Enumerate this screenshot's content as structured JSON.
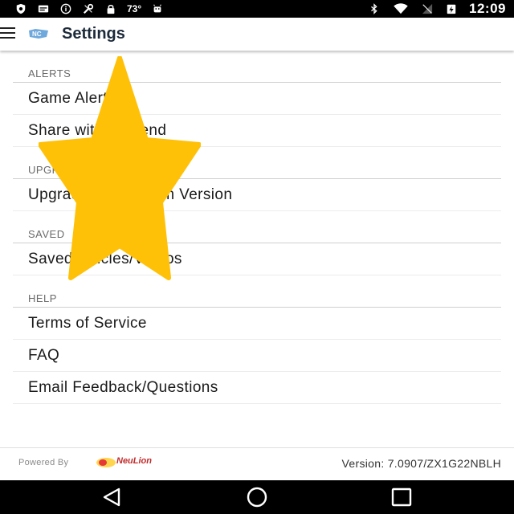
{
  "status_bar": {
    "temperature": "73°",
    "time": "12:09",
    "icons": [
      "shield-icon",
      "message-icon",
      "info-icon",
      "wrench-icon",
      "lock-icon",
      "android-icon",
      "bluetooth-icon",
      "wifi-icon",
      "signal-off-icon",
      "battery-charging-icon"
    ]
  },
  "app_bar": {
    "title": "Settings",
    "menu_icon": "hamburger-menu-icon",
    "logo_icon": "nc-logo-icon"
  },
  "sections": [
    {
      "header": "ALERTS",
      "items": [
        "Game Alerts",
        "Share with a Friend"
      ]
    },
    {
      "header": "UPGRADE",
      "items": [
        "Upgrade to Premium Version"
      ]
    },
    {
      "header": "SAVED",
      "items": [
        "Saved Articles/Videos"
      ]
    },
    {
      "header": "HELP",
      "items": [
        "Terms of Service",
        "FAQ",
        "Email Feedback/Questions"
      ]
    }
  ],
  "footer": {
    "powered_by": "Powered By",
    "brand": "NeuLion",
    "version": "Version: 7.0907/ZX1G22NBLH"
  },
  "nav_bar": {
    "icons": [
      "back-icon",
      "home-icon",
      "recents-icon"
    ]
  },
  "overlay": {
    "icon": "star-icon",
    "color": "#FFC107"
  }
}
